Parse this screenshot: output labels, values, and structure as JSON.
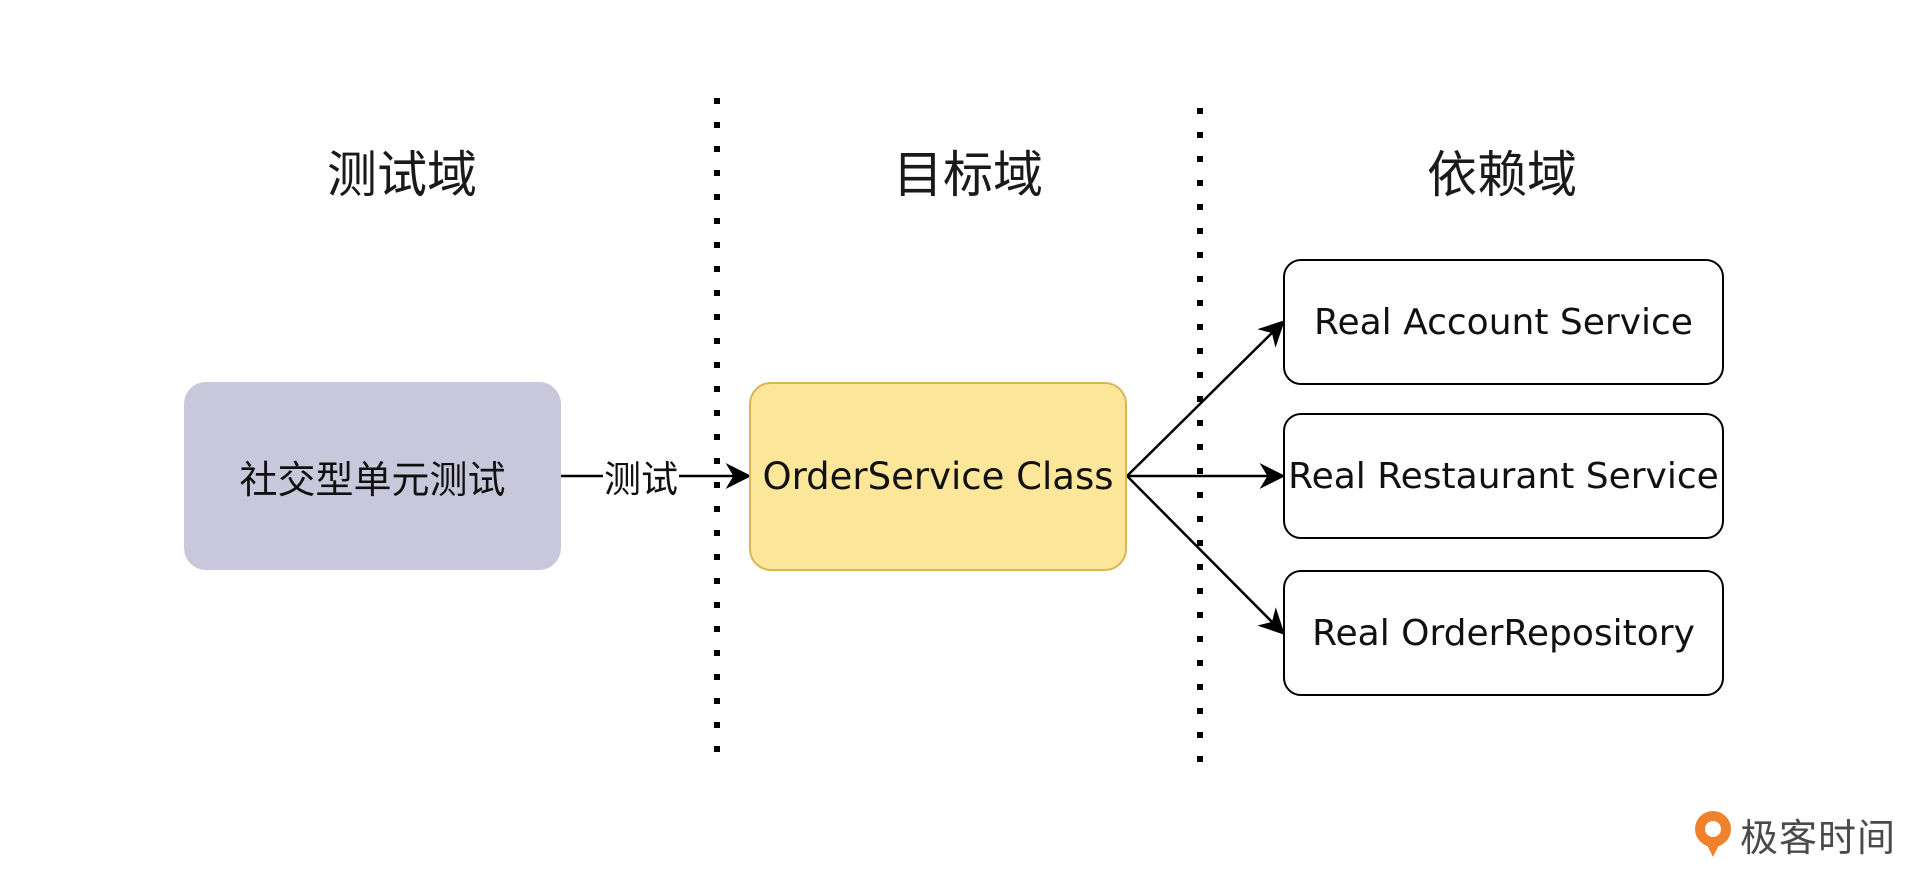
{
  "domains": {
    "test": "测试域",
    "target": "目标域",
    "dependency": "依赖域"
  },
  "nodes": {
    "test_unit": "社交型单元测试",
    "order_service": "OrderService Class",
    "deps": [
      "Real Account Service",
      "Real Restaurant Service",
      "Real OrderRepository"
    ]
  },
  "edge_label": "测试",
  "brand": {
    "name": "极客时间",
    "logo_icon": "geektime-logo-icon"
  },
  "colors": {
    "test_box": "#c8c7dc",
    "target_box": "#fce699",
    "target_border": "#d6b656",
    "brand_orange": "#f0822d"
  }
}
